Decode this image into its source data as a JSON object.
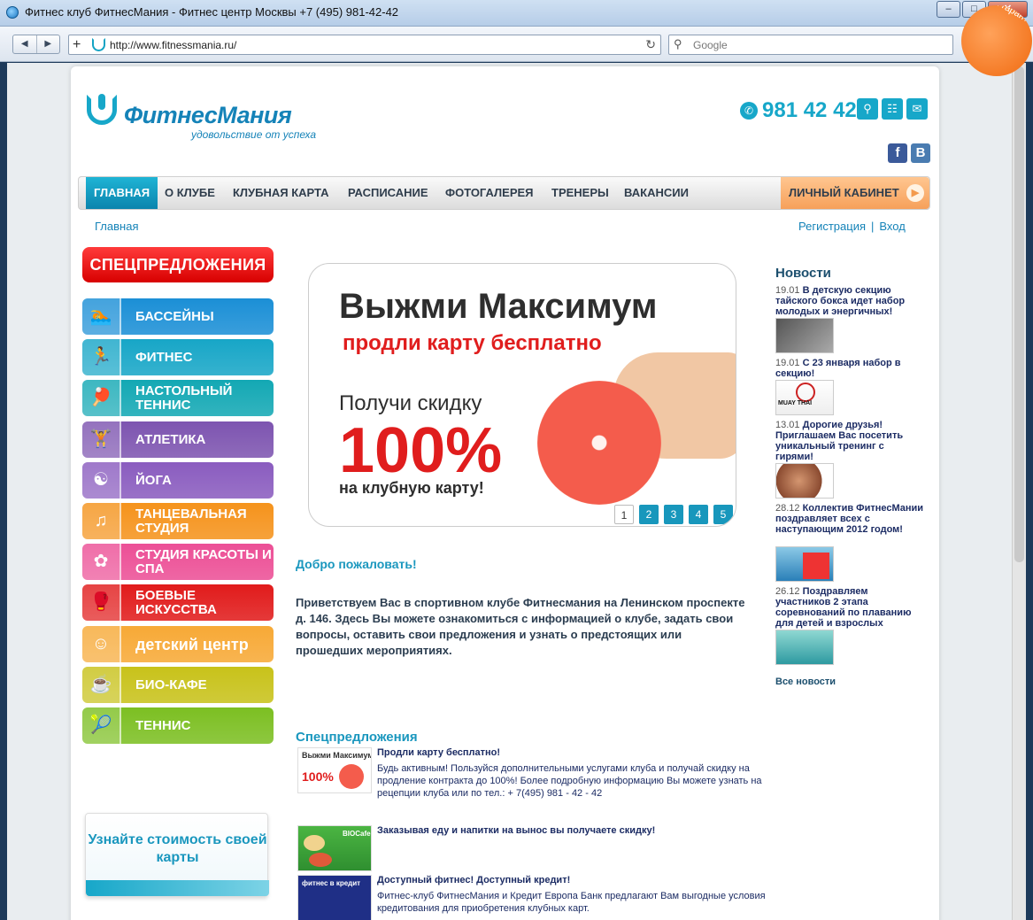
{
  "window": {
    "title": "Фитнес клуб ФитнесМания - Фитнес центр Москвы +7 (495) 981-42-42",
    "controls": {
      "minimize": "–",
      "maximize": "□",
      "close": "✕"
    }
  },
  "browser": {
    "url": "http://www.fitnessmania.ru/",
    "search_placeholder": "Google"
  },
  "header": {
    "logo_name": "ФитнесМания",
    "logo_tagline": "удовольствие от успеха",
    "phone": "981 42 42",
    "corner_badge": "Мы гарантируем результат"
  },
  "nav": {
    "items": [
      "ГЛАВНАЯ",
      "О КЛУБЕ",
      "КЛУБНАЯ КАРТА",
      "РАСПИСАНИЕ",
      "ФОТОГАЛЕРЕЯ",
      "ТРЕНЕРЫ",
      "ВАКАНСИИ"
    ],
    "cabinet": "ЛИЧНЫЙ КАБИНЕТ"
  },
  "breadcrumb": "Главная",
  "auth": {
    "register": "Регистрация",
    "separator": "|",
    "login": "Вход"
  },
  "left_menu": {
    "special": "СПЕЦПРЕДЛОЖЕНИЯ",
    "items": [
      {
        "label": "БАССЕЙНЫ",
        "color": "#1b8fd6",
        "icon": "swimmer-icon"
      },
      {
        "label": "ФИТНЕС",
        "color": "#17a6c7",
        "icon": "runner-icon"
      },
      {
        "label": "НАСТОЛЬНЫЙ ТЕННИС",
        "color": "#13a8b4",
        "icon": "table-tennis-icon"
      },
      {
        "label": "АТЛЕТИКА",
        "color": "#7d54b0",
        "icon": "weightlifter-icon"
      },
      {
        "label": "ЙОГА",
        "color": "#8a5cbf",
        "icon": "yoga-icon"
      },
      {
        "label": "ТАНЦЕВАЛЬНАЯ СТУДИЯ",
        "color": "#f5931c",
        "icon": "dancers-icon"
      },
      {
        "label": "СТУДИЯ КРАСОТЫ И СПА",
        "color": "#ec4f96",
        "icon": "spa-icon"
      },
      {
        "label": "БОЕВЫЕ ИСКУССТВА",
        "color": "#e11b1b",
        "icon": "fighter-icon"
      },
      {
        "label": "детский центр",
        "color": "#f7a936",
        "icon": "kids-icon"
      },
      {
        "label": "БИО-КАФЕ",
        "color": "#c8c21a",
        "icon": "cafe-icon"
      },
      {
        "label": "ТЕННИС",
        "color": "#7cbf22",
        "icon": "tennis-icon"
      }
    ],
    "price_banner": "Узнайте стоимость своей карты"
  },
  "slider": {
    "headline": "Выжми Максимум",
    "subhead": "продли карту бесплатно",
    "line3": "Получи скидку",
    "big": "100%",
    "line4": "на клубную карту!",
    "pages": [
      "1",
      "2",
      "3",
      "4",
      "5"
    ],
    "active_page": "1"
  },
  "welcome": {
    "title": "Добро пожаловать!",
    "text": "Приветствуем Вас в спортивном клубе Фитнесмания на Ленинском проспекте д. 146. Здесь Вы можете ознакомиться с информацией о клубе, задать свои вопросы, оставить свои предложения и узнать о предстоящих или прошедших мероприятиях."
  },
  "offers": {
    "title": "Спецпредложения",
    "items": [
      {
        "title": "Продли карту бесплатно!",
        "text": "Будь активным! Пользуйся дополнительными услугами клуба и получай скидку на продление контракта до 100%! Более подробную информацию Вы можете узнать на рецепции клуба или по тел.: + 7(495) 981 - 42 - 42",
        "thumb_a": "Выжми Максимум",
        "thumb_b": "100%"
      },
      {
        "title": "Заказывая еду и напитки на вынос вы получаете скидку!",
        "text": "",
        "thumb_a": "BIOCafe"
      },
      {
        "title": "Доступный фитнес! Доступный кредит!",
        "text": "Фитнес-клуб ФитнесМания и Кредит Европа Банк предлагают Вам выгодные условия кредитования для приобретения клубных карт.",
        "thumb_a": "фитнес в кредит"
      }
    ]
  },
  "news": {
    "title": "Новости",
    "items": [
      {
        "date": "19.01",
        "text": "В детскую секцию тайского бокса идет набор молодых и энергичных!"
      },
      {
        "date": "19.01",
        "text": "С 23 января набор в секцию!",
        "img_label": "MUAY THAI"
      },
      {
        "date": "13.01",
        "text": "Дорогие друзья! Приглашаем Вас посетить уникальный тренинг с гирями!"
      },
      {
        "date": "28.12",
        "text": "Коллектив ФитнесМании поздравляет всех с наступающим 2012 годом!"
      },
      {
        "date": "26.12",
        "text": "Поздравляем участников 2 этапа соревнований по плаванию для детей и взрослых"
      }
    ],
    "all": "Все новости"
  }
}
